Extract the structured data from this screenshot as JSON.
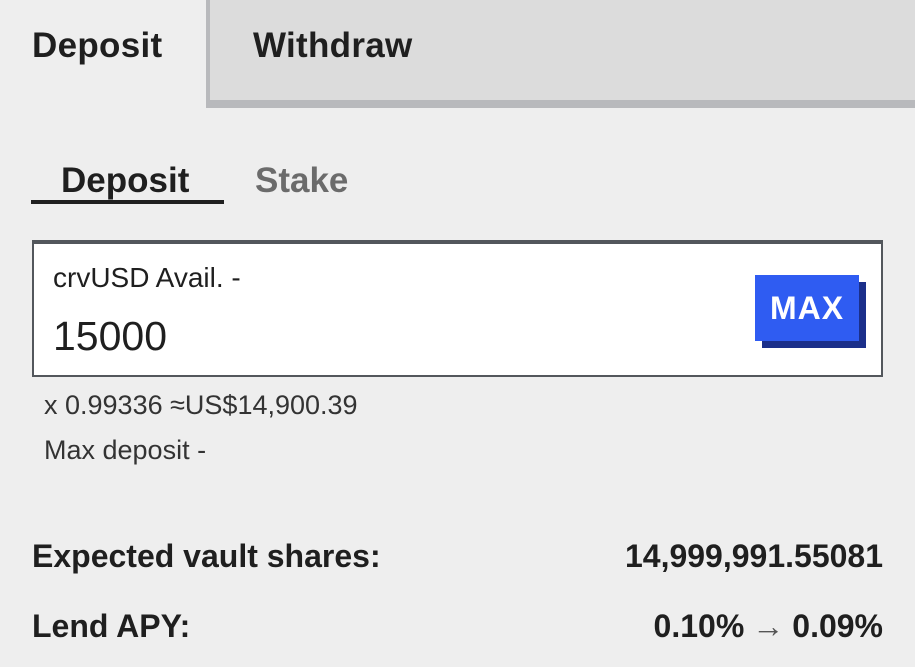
{
  "top_tabs": {
    "deposit": "Deposit",
    "withdraw": "Withdraw"
  },
  "sub_tabs": {
    "deposit": "Deposit",
    "stake": "Stake"
  },
  "input": {
    "label": "crvUSD Avail. -",
    "value": "15000",
    "max_label": "MAX"
  },
  "helper": {
    "rate": "x 0.99336 ≈US$14,900.39",
    "max_deposit": "Max deposit -"
  },
  "details": {
    "vault_shares_label": "Expected vault shares:",
    "vault_shares_value": "14,999,991.55081",
    "apy_label": "Lend APY:",
    "apy_from": "0.10%",
    "apy_arrow": "→",
    "apy_to": "0.09%"
  },
  "colors": {
    "background": "#eeeeee",
    "inactive_tab": "#dcdcdc",
    "accent": "#2f5cf2",
    "accent_shadow": "#1b2f8a"
  },
  "icons": {
    "arrow": "arrow-right-icon"
  }
}
